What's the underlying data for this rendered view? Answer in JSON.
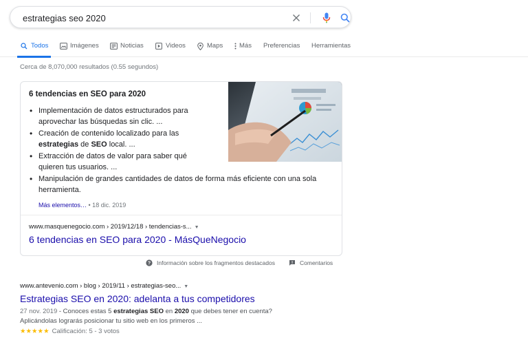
{
  "search": {
    "query": "estrategias seo 2020"
  },
  "tabs": [
    {
      "label": "Todos",
      "icon": "search-icon"
    },
    {
      "label": "Imágenes",
      "icon": "image-icon"
    },
    {
      "label": "Noticias",
      "icon": "news-icon"
    },
    {
      "label": "Videos",
      "icon": "video-icon"
    },
    {
      "label": "Maps",
      "icon": "map-pin-icon"
    },
    {
      "label": "Más",
      "icon": "more-vert-icon"
    },
    {
      "label": "Preferencias"
    },
    {
      "label": "Herramientas"
    }
  ],
  "stats": "Cerca de 8,070,000 resultados (0.55 segundos)",
  "featured": {
    "title": "6 tendencias en SEO para 2020",
    "bullets": [
      {
        "parts": [
          "Implementación de datos estructurados para aprovechar las búsquedas sin clic. ..."
        ]
      },
      {
        "pre": "Creación de contenido localizado para las ",
        "b1": "estrategias",
        "mid": " de ",
        "b2": "SEO",
        "post": " local. ..."
      },
      {
        "parts": [
          "Extracción de datos de valor para saber qué quieren tus usuarios. ..."
        ]
      },
      {
        "parts": [
          "Manipulación de grandes cantidades de datos de forma más eficiente con una sola herramienta."
        ]
      }
    ],
    "more_link": "Más elementos…",
    "more_date": " • 18 dic. 2019",
    "url": "www.masquenegocio.com › 2019/12/18 › tendencias-s...",
    "link_title": "6 tendencias en SEO para 2020 - MásQueNegocio",
    "footer_info": "Información sobre los fragmentos destacados",
    "footer_feedback": "Comentarios"
  },
  "result2": {
    "url": "www.antevenio.com › blog › 2019/11 › estrategias-seo...",
    "title": "Estrategias SEO en 2020: adelanta a tus competidores",
    "date": "27 nov. 2019",
    "snippet_a": " - Conoces estas 5 ",
    "bold_a": "estrategias SEO",
    "snippet_b": " en ",
    "bold_b": "2020",
    "snippet_c": " que debes tener en cuenta?",
    "snippet_line2": "Aplicándolas lograrás posicionar tu sitio web en los primeros ...",
    "stars": "★★★★★",
    "rating": "Calificación: 5 - 3 votos"
  },
  "colors": {
    "link": "#1a0dab",
    "accent": "#1a73e8",
    "star": "#fbbc04"
  }
}
